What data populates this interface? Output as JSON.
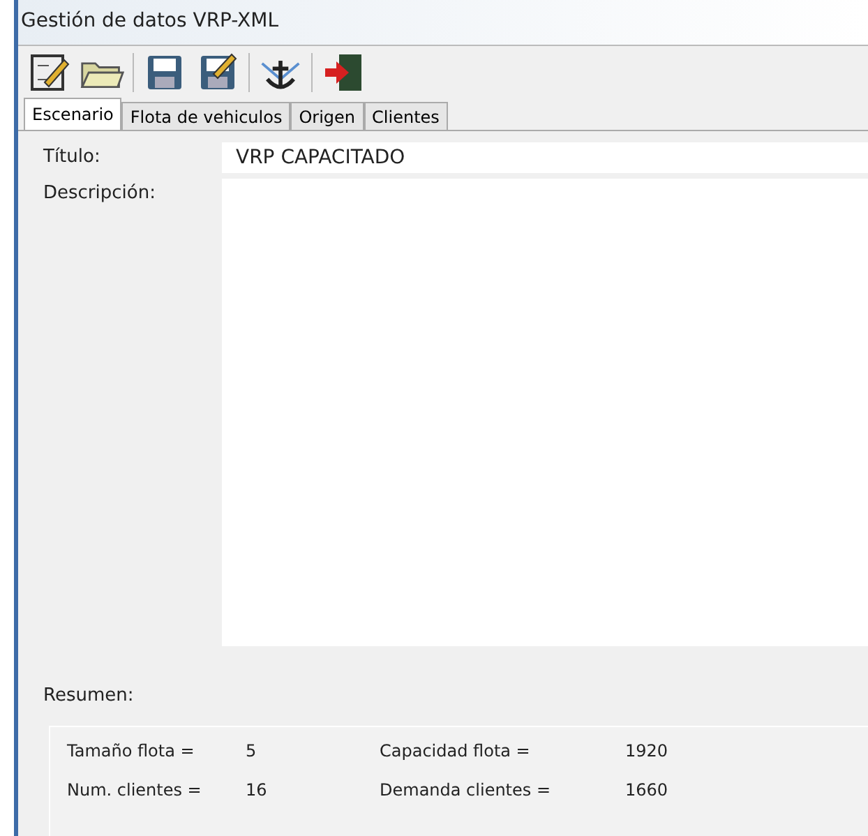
{
  "window": {
    "title": "Gestión de datos VRP-XML"
  },
  "tabs": [
    {
      "label": "Escenario",
      "selected": true
    },
    {
      "label": "Flota de vehiculos",
      "selected": false
    },
    {
      "label": "Origen",
      "selected": false
    },
    {
      "label": "Clientes",
      "selected": false
    }
  ],
  "form": {
    "title_label": "Título:",
    "title_value": "VRP CAPACITADO",
    "description_label": "Descripción:"
  },
  "summary": {
    "label": "Resumen:",
    "items": [
      {
        "label": "Tamaño flota =",
        "value": "5"
      },
      {
        "label": "Capacidad flota =",
        "value": "1920"
      },
      {
        "label": "Num. clientes =",
        "value": "16"
      },
      {
        "label": "Demanda clientes =",
        "value": "1660"
      }
    ]
  }
}
